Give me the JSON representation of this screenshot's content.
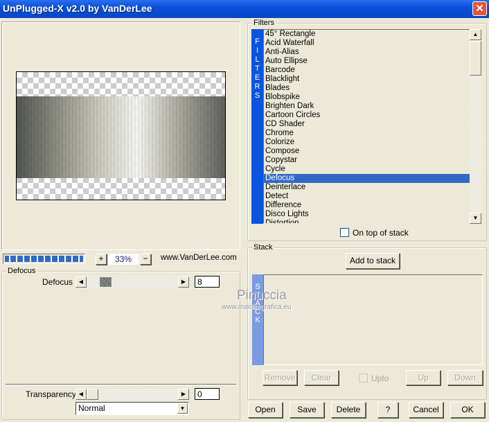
{
  "window": {
    "title": "UnPlugged-X v2.0 by VanDerLee",
    "close_icon": "close-icon"
  },
  "preview": {
    "progress_percent": 100,
    "zoom_in": "+",
    "zoom_value": "33%",
    "zoom_out": "−",
    "website": "www.VanDerLee.com"
  },
  "params": {
    "group_label": "Defocus",
    "defocus_label": "Defocus",
    "defocus_value": "8",
    "transparency_label": "Transparency",
    "transparency_value": "0",
    "blend_mode": "Normal"
  },
  "filters": {
    "group_label": "Filters",
    "strip_letters": [
      "F",
      "I",
      "L",
      "T",
      "E",
      "R",
      "S"
    ],
    "items": [
      "45° Rectangle",
      "Acid Waterfall",
      "Anti-Alias",
      "Auto Ellipse",
      "Barcode",
      "Blacklight",
      "Blades",
      "Blobspike",
      "Brighten Dark",
      "Cartoon Circles",
      "CD Shader",
      "Chrome",
      "Colorize",
      "Compose",
      "Copystar",
      "Cycle",
      "Defocus",
      "Deinterlace",
      "Detect",
      "Difference",
      "Disco Lights",
      "Distortion"
    ],
    "selected": "Defocus",
    "on_top_label": "On top of stack",
    "on_top_checked": false
  },
  "stack": {
    "group_label": "Stack",
    "add_label": "Add to stack",
    "strip_letters": [
      "S",
      "T",
      "A",
      "C",
      "K"
    ],
    "remove": "Remove",
    "clear": "Clear",
    "upto": "Upto",
    "up": "Up",
    "down": "Down"
  },
  "watermark": {
    "name": "Pinuccia",
    "url": "www.maidiregrafica.eu"
  },
  "footer": {
    "open": "Open",
    "save": "Save",
    "delete": "Delete",
    "help": "?",
    "cancel": "Cancel",
    "ok": "OK"
  },
  "colors": {
    "titlebar": "#0a50d8",
    "selection": "#316ac5",
    "filters_strip": "#0a55e0",
    "stack_strip": "#7b9ae0"
  }
}
